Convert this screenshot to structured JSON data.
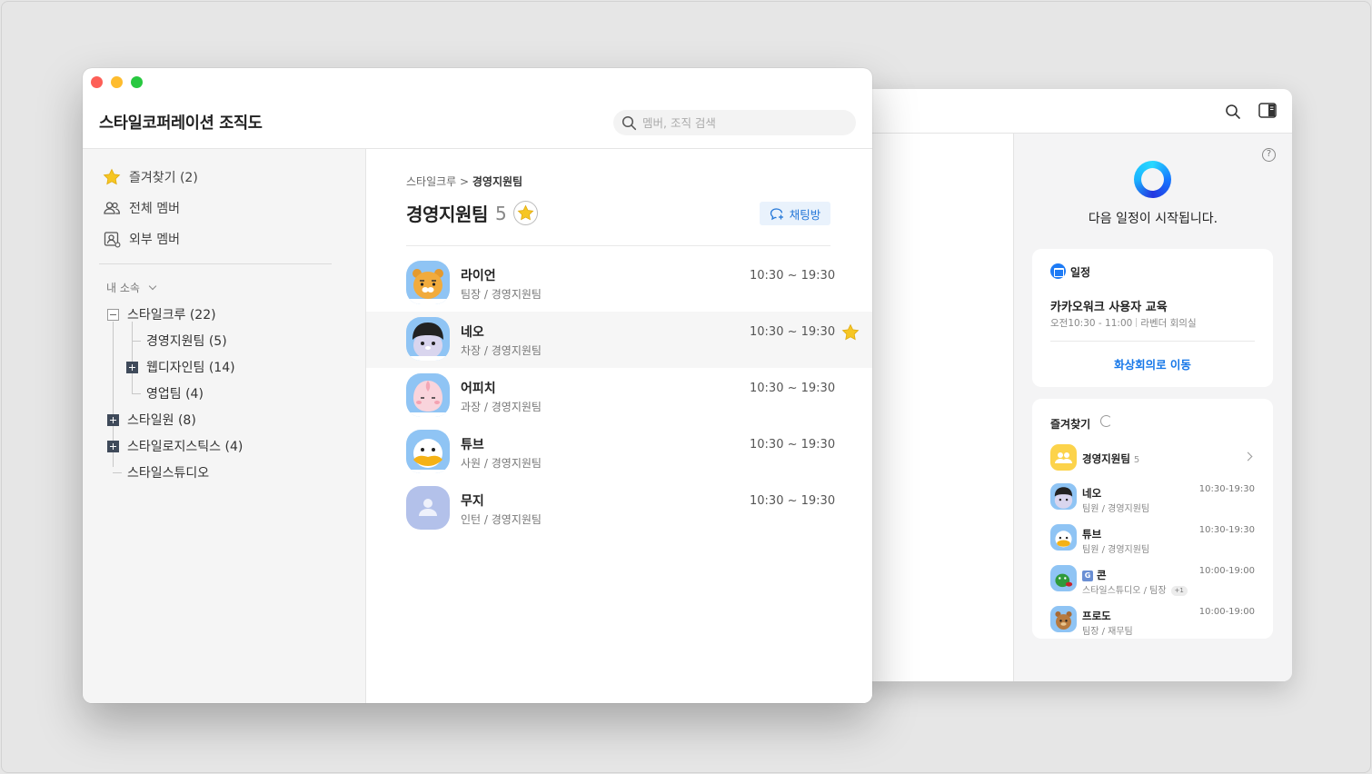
{
  "front": {
    "title": "스타일코퍼레이션 조직도",
    "search": {
      "placeholder": "멤버, 조직 검색",
      "value": ""
    }
  },
  "sidebar": {
    "nav": [
      {
        "label": "즐겨찾기 (2)",
        "icon": "star-icon"
      },
      {
        "label": "전체 멤버",
        "icon": "people-icon"
      },
      {
        "label": "외부 멤버",
        "icon": "external-member-icon"
      }
    ],
    "section_label": "내 소속",
    "tree": [
      {
        "label": "스타일크루 (22)",
        "level": 0,
        "toggle": "minus"
      },
      {
        "label": "경영지원팀 (5)",
        "level": 1,
        "toggle": "none"
      },
      {
        "label": "웹디자인팀 (14)",
        "level": 1,
        "toggle": "plus"
      },
      {
        "label": "영업팀 (4)",
        "level": 1,
        "toggle": "none"
      },
      {
        "label": "스타일원 (8)",
        "level": 0,
        "toggle": "plus"
      },
      {
        "label": "스타일로지스틱스 (4)",
        "level": 0,
        "toggle": "plus"
      },
      {
        "label": "스타일스튜디오",
        "level": 0,
        "toggle": "none"
      }
    ]
  },
  "main": {
    "breadcrumb_parent": "스타일크루",
    "breadcrumb_sep": " > ",
    "breadcrumb_current": "경영지원팀",
    "team_name": "경영지원팀",
    "team_count": "5",
    "chat_button": "채팅방",
    "members": [
      {
        "name": "라이언",
        "role": "팀장 / 경영지원팀",
        "hours": "10:30 ~ 19:30",
        "favorite": false,
        "avatar": "lion"
      },
      {
        "name": "네오",
        "role": "차장 / 경영지원팀",
        "hours": "10:30 ~ 19:30",
        "favorite": true,
        "avatar": "neo"
      },
      {
        "name": "어피치",
        "role": "과장 / 경영지원팀",
        "hours": "10:30 ~ 19:30",
        "favorite": false,
        "avatar": "apeach"
      },
      {
        "name": "튜브",
        "role": "사원 / 경영지원팀",
        "hours": "10:30 ~ 19:30",
        "favorite": false,
        "avatar": "tube"
      },
      {
        "name": "무지",
        "role": "인턴 / 경영지원팀",
        "hours": "10:30 ~ 19:30",
        "favorite": false,
        "avatar": "default"
      }
    ]
  },
  "back": {
    "next_message": "다음 일정이 시작됩니다.",
    "schedule": {
      "header": "일정",
      "event": "카카오워크 사용자 교육",
      "time": "오전10:30 - 11:00",
      "place": "라벤더 회의실",
      "action": "화상회의로 이동"
    },
    "favorites": {
      "header": "즐겨찾기",
      "group": {
        "name": "경영지원팀",
        "count": "5"
      },
      "people": [
        {
          "name": "네오",
          "sub": "팀원 / 경영지원팀",
          "time": "10:30-19:30",
          "avatar": "neo"
        },
        {
          "name": "튜브",
          "sub": "팀원 / 경영지원팀",
          "time": "10:30-19:30",
          "avatar": "tube"
        },
        {
          "name": "콘",
          "badge": "G",
          "sub": "스타일스튜디오 / 팀장",
          "extra": "+1",
          "time": "10:00-19:00",
          "avatar": "con"
        },
        {
          "name": "프로도",
          "sub": "팀장 / 재무팀",
          "time": "10:00-19:00",
          "avatar": "frodo"
        }
      ]
    }
  },
  "colors": {
    "accent": "#1677e8",
    "star": "#f6c623",
    "chat_bg": "#e9f2fc"
  }
}
